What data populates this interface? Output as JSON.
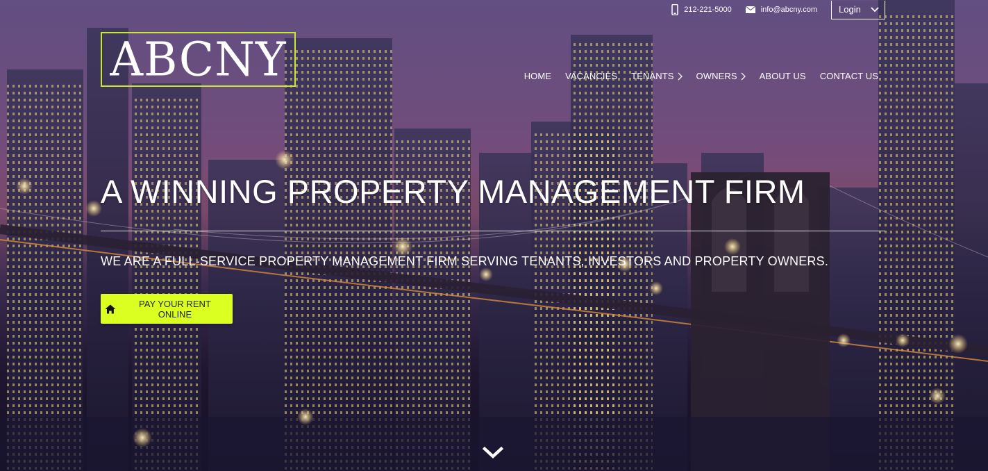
{
  "header": {
    "phone": "212-221-5000",
    "email": "info@abcny.com",
    "login_label": "Login",
    "logo_text": "ABCNY",
    "accent_color": "#c6ea2b"
  },
  "nav": {
    "items": [
      {
        "label": "HOME",
        "has_submenu": false
      },
      {
        "label": "VACANCIES",
        "has_submenu": false
      },
      {
        "label": "TENANTS",
        "has_submenu": true
      },
      {
        "label": "OWNERS",
        "has_submenu": true
      },
      {
        "label": "ABOUT US",
        "has_submenu": false
      },
      {
        "label": "CONTACT US",
        "has_submenu": false
      }
    ]
  },
  "hero": {
    "headline": "A WINNING PROPERTY MANAGEMENT FIRM",
    "subheadline": "WE ARE A FULL-SERVICE PROPERTY MANAGEMENT FIRM SERVING TENANTS, INVESTORS AND PROPERTY OWNERS.",
    "cta_label": "PAY YOUR RENT ONLINE",
    "cta_color": "#dcff22",
    "cta_icon": "home-icon",
    "scroll_icon": "chevron-down-icon"
  }
}
